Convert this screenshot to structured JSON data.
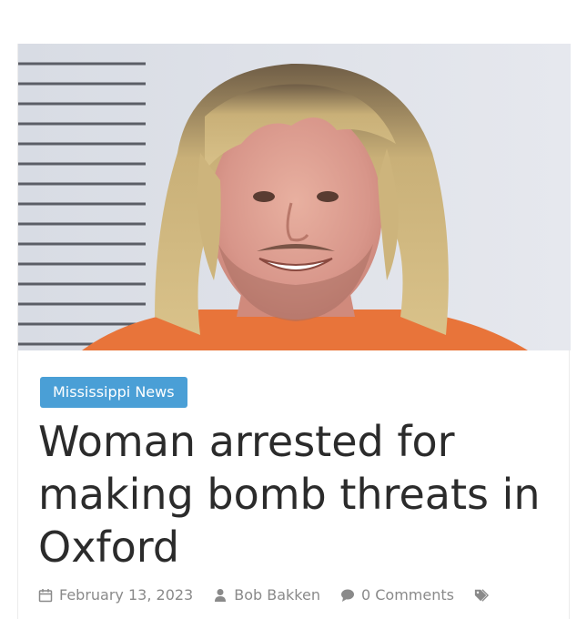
{
  "article": {
    "category": "Mississippi News",
    "title": "Woman arrested for making bomb threats in Oxford",
    "meta": {
      "date": "February 13, 2023",
      "author": "Bob Bakken",
      "comments": "0 Comments"
    }
  },
  "icons": {
    "date": "calendar-icon",
    "author": "user-icon",
    "comments": "comment-icon",
    "tags": "tag-icon"
  },
  "colors": {
    "badge_background": "#4a9fd6",
    "badge_text": "#ffffff",
    "title_text": "#2b2b2b",
    "meta_text": "#8a8a8a"
  }
}
